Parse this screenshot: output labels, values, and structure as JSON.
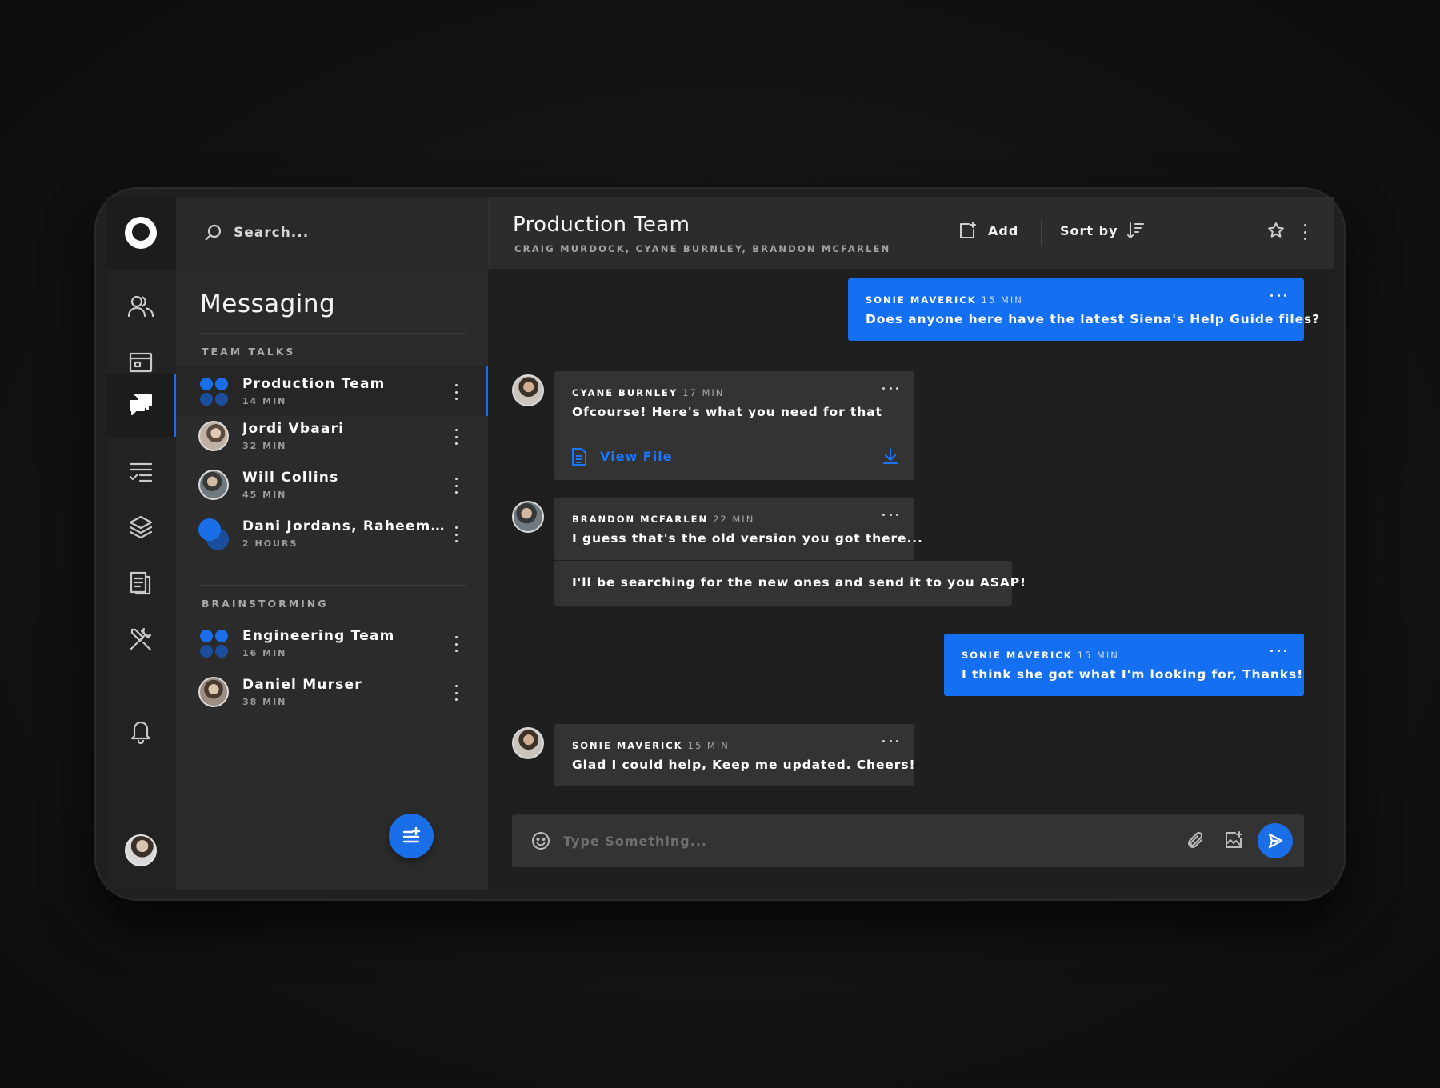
{
  "search": {
    "placeholder": "Search..."
  },
  "sidebar": {
    "title": "Messaging",
    "sections": [
      {
        "label": "TEAM TALKS",
        "items": [
          {
            "name": "Production Team",
            "time": "14 MIN",
            "active": true
          },
          {
            "name": "Jordi Vbaari",
            "time": "32 MIN"
          },
          {
            "name": "Will Collins",
            "time": "45 MIN"
          },
          {
            "name": "Dani Jordans, Raheem St...",
            "time": "2 HOURS"
          }
        ]
      },
      {
        "label": "BRAINSTORMING",
        "items": [
          {
            "name": "Engineering Team",
            "time": "16 MIN"
          },
          {
            "name": "Daniel Murser",
            "time": "38 MIN"
          }
        ]
      }
    ]
  },
  "rail": {
    "icons": [
      "people-icon",
      "browser-icon",
      "chat-icon",
      "tasks-icon",
      "layers-icon",
      "documents-icon",
      "tools-icon",
      "bell-icon"
    ],
    "active": "chat-icon"
  },
  "chat": {
    "title": "Production Team",
    "members": "CRAIG MURDOCK, CYANE BURNLEY, BRANDON MCFARLEN",
    "add_label": "Add",
    "sort_label": "Sort by",
    "messages": [
      {
        "author": "SONIE MAVERICK",
        "time": "15 MIN",
        "text": "Does anyone here have the latest Siena's Help Guide files?",
        "mine": true
      },
      {
        "author": "CYANE BURNLEY",
        "time": "17 MIN",
        "text": "Ofcourse! Here's what you need for that",
        "attachment": "View File",
        "mine": false
      },
      {
        "author": "BRANDON MCFARLEN",
        "time": "22 MIN",
        "text": "I guess that's the old version you got there...",
        "followup": "I'll be searching for the new ones and send it to you ASAP!",
        "mine": false
      },
      {
        "author": "SONIE MAVERICK",
        "time": "15 MIN",
        "text": "I think she got what I'm looking for, Thanks!",
        "mine": true
      },
      {
        "author": "SONIE MAVERICK",
        "time": "15 MIN",
        "text": "Glad I could help, Keep me updated. Cheers!",
        "mine": false
      }
    ],
    "composer_placeholder": "Type Something..."
  },
  "colors": {
    "accent": "#1a6fe8",
    "bubble_mine": "#1470f0",
    "bubble_theirs": "#333333",
    "background": "#1f1f1f"
  }
}
